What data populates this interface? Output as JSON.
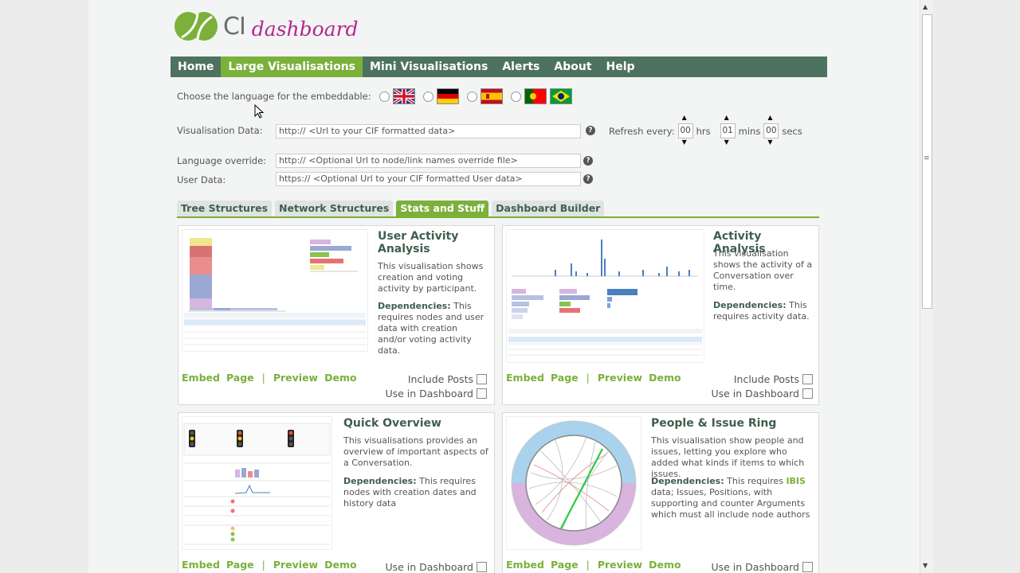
{
  "logo": {
    "ci": "CI",
    "dashboard": "dashboard"
  },
  "nav": [
    "Home",
    "Large Visualisations",
    "Mini Visualisations",
    "Alerts",
    "About",
    "Help"
  ],
  "nav_active": 1,
  "language": {
    "label": "Choose the language for the embeddable:"
  },
  "form": {
    "vis_label": "Visualisation Data:",
    "vis_placeholder": "http:// <Url to your CIF formatted data>",
    "lang_label": "Language override:",
    "lang_placeholder": "http:// <Optional Url to node/link names override file>",
    "user_label": "User Data:",
    "user_placeholder": "https:// <Optional Url to your CIF formatted User data>",
    "help": "?"
  },
  "refresh": {
    "label": "Refresh every:",
    "hrs": "00",
    "hrs_unit": "hrs",
    "mins": "01",
    "mins_unit": "mins",
    "secs": "00",
    "secs_unit": "secs"
  },
  "tabs": [
    "Tree Structures",
    "Network Structures",
    "Stats and Stuff",
    "Dashboard Builder"
  ],
  "cards": {
    "user_activity": {
      "title": "User Activity Analysis",
      "desc": "This visualisation shows creation and voting activity by participant.",
      "deps_label": "Dependencies:",
      "deps": " This requires nodes and user data with creation and/or voting activity data.",
      "include_posts": "Include Posts",
      "use_dashboard": "Use in Dashboard"
    },
    "activity": {
      "title": "Activity Analysis",
      "desc": "This visualisation shows the activity of a Conversation over time.",
      "deps_label": "Dependencies:",
      "deps": " This requires activity data.",
      "include_posts": "Include Posts",
      "use_dashboard": "Use in Dashboard"
    },
    "quick": {
      "title": "Quick Overview",
      "desc": "This visualisations provides an overview of important aspects of a Conversation.",
      "deps_label": "Dependencies:",
      "deps": " This requires nodes with creation dates and history data",
      "use_dashboard": "Use in Dashboard"
    },
    "ring": {
      "title": "People & Issue Ring",
      "desc": "This visualisation show people and issues, letting you explore who added what kinds if items to which issues.",
      "deps_label": "Dependencies:",
      "deps_a": " This requires ",
      "deps_hl": "IBIS",
      "deps_b": " data; Issues, Positions, with supporting and counter Arguments which must all include node authors",
      "use_dashboard": "Use in Dashboard"
    }
  },
  "links": {
    "embed": "Embed",
    "page": "Page",
    "sep": "|",
    "preview": "Preview",
    "demo": "Demo"
  },
  "colors": {
    "nav": "#4e7260",
    "accent": "#7bb03b",
    "title": "#3f5f4d",
    "logo_pink": "#b02a8d"
  }
}
